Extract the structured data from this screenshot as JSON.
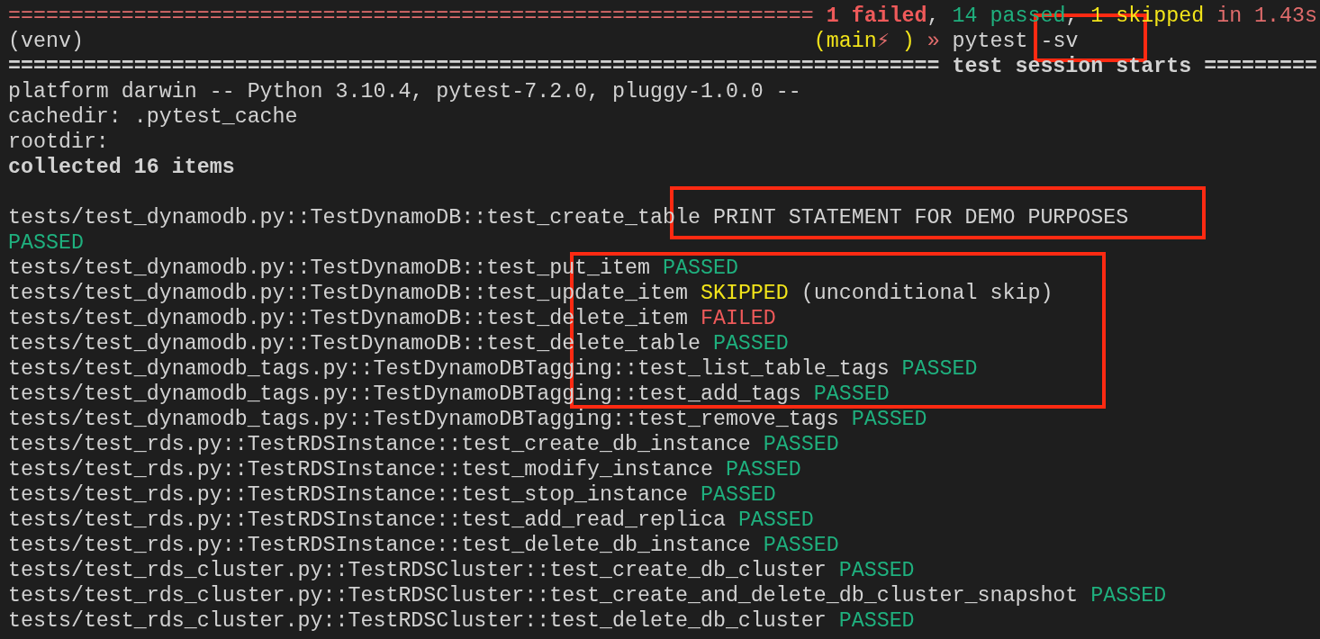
{
  "terminal": {
    "lines": [
      {
        "segments": [
          {
            "kind": "rule-red",
            "text": "================================================================ "
          },
          {
            "kind": "failed-bold",
            "text": "1 failed"
          },
          {
            "kind": "plain",
            "text": ", "
          },
          {
            "kind": "passed",
            "text": "14 passed"
          },
          {
            "kind": "plain",
            "text": ", "
          },
          {
            "kind": "skipped",
            "text": "1 skipped"
          },
          {
            "kind": "summary",
            "text": " in 1.43s"
          }
        ]
      },
      {
        "segments": [
          {
            "kind": "plain",
            "text": "(venv)                                                          "
          },
          {
            "kind": "skipped",
            "text": "(main"
          },
          {
            "kind": "summary",
            "text": "⚡"
          },
          {
            "kind": "skipped",
            "text": " )"
          },
          {
            "kind": "summary",
            "text": " »"
          },
          {
            "kind": "plain",
            "text": " pytest -sv"
          }
        ]
      },
      {
        "segments": [
          {
            "kind": "rule-bold",
            "text": "========================================================================== test session starts ========="
          }
        ]
      },
      {
        "segments": [
          {
            "kind": "plain",
            "text": "platform darwin -- Python 3.10.4, pytest-7.2.0, pluggy-1.0.0 --"
          }
        ]
      },
      {
        "segments": [
          {
            "kind": "plain",
            "text": "cachedir: .pytest_cache"
          }
        ]
      },
      {
        "segments": [
          {
            "kind": "plain",
            "text": "rootdir:"
          }
        ]
      },
      {
        "segments": [
          {
            "kind": "bold",
            "text": "collected 16 items"
          }
        ]
      },
      {
        "blank_line_before": true,
        "segments": [
          {
            "kind": "plain",
            "text": "tests/test_dynamodb.py::TestDynamoDB::test_create_table PRINT STATEMENT FOR DEMO PURPOSES"
          }
        ]
      },
      {
        "segments": [
          {
            "kind": "passed",
            "text": "PASSED"
          }
        ]
      },
      {
        "segments": [
          {
            "kind": "plain",
            "text": "tests/test_dynamodb.py::TestDynamoDB::test_put_item "
          },
          {
            "kind": "passed",
            "text": "PASSED"
          }
        ]
      },
      {
        "segments": [
          {
            "kind": "plain",
            "text": "tests/test_dynamodb.py::TestDynamoDB::test_update_item "
          },
          {
            "kind": "skipped",
            "text": "SKIPPED"
          },
          {
            "kind": "plain",
            "text": " (unconditional skip)"
          }
        ]
      },
      {
        "segments": [
          {
            "kind": "plain",
            "text": "tests/test_dynamodb.py::TestDynamoDB::test_delete_item "
          },
          {
            "kind": "failed",
            "text": "FAILED"
          }
        ]
      },
      {
        "segments": [
          {
            "kind": "plain",
            "text": "tests/test_dynamodb.py::TestDynamoDB::test_delete_table "
          },
          {
            "kind": "passed",
            "text": "PASSED"
          }
        ]
      },
      {
        "segments": [
          {
            "kind": "plain",
            "text": "tests/test_dynamodb_tags.py::TestDynamoDBTagging::test_list_table_tags "
          },
          {
            "kind": "passed",
            "text": "PASSED"
          }
        ]
      },
      {
        "segments": [
          {
            "kind": "plain",
            "text": "tests/test_dynamodb_tags.py::TestDynamoDBTagging::test_add_tags "
          },
          {
            "kind": "passed",
            "text": "PASSED"
          }
        ]
      },
      {
        "segments": [
          {
            "kind": "plain",
            "text": "tests/test_dynamodb_tags.py::TestDynamoDBTagging::test_remove_tags "
          },
          {
            "kind": "passed",
            "text": "PASSED"
          }
        ]
      },
      {
        "segments": [
          {
            "kind": "plain",
            "text": "tests/test_rds.py::TestRDSInstance::test_create_db_instance "
          },
          {
            "kind": "passed",
            "text": "PASSED"
          }
        ]
      },
      {
        "segments": [
          {
            "kind": "plain",
            "text": "tests/test_rds.py::TestRDSInstance::test_modify_instance "
          },
          {
            "kind": "passed",
            "text": "PASSED"
          }
        ]
      },
      {
        "segments": [
          {
            "kind": "plain",
            "text": "tests/test_rds.py::TestRDSInstance::test_stop_instance "
          },
          {
            "kind": "passed",
            "text": "PASSED"
          }
        ]
      },
      {
        "segments": [
          {
            "kind": "plain",
            "text": "tests/test_rds.py::TestRDSInstance::test_add_read_replica "
          },
          {
            "kind": "passed",
            "text": "PASSED"
          }
        ]
      },
      {
        "segments": [
          {
            "kind": "plain",
            "text": "tests/test_rds.py::TestRDSInstance::test_delete_db_instance "
          },
          {
            "kind": "passed",
            "text": "PASSED"
          }
        ]
      },
      {
        "segments": [
          {
            "kind": "plain",
            "text": "tests/test_rds_cluster.py::TestRDSCluster::test_create_db_cluster "
          },
          {
            "kind": "passed",
            "text": "PASSED"
          }
        ]
      },
      {
        "segments": [
          {
            "kind": "plain",
            "text": "tests/test_rds_cluster.py::TestRDSCluster::test_create_and_delete_db_cluster_snapshot "
          },
          {
            "kind": "passed",
            "text": "PASSED"
          }
        ]
      },
      {
        "segments": [
          {
            "kind": "plain",
            "text": "tests/test_rds_cluster.py::TestRDSCluster::test_delete_db_cluster "
          },
          {
            "kind": "passed",
            "text": "PASSED"
          }
        ]
      }
    ]
  }
}
